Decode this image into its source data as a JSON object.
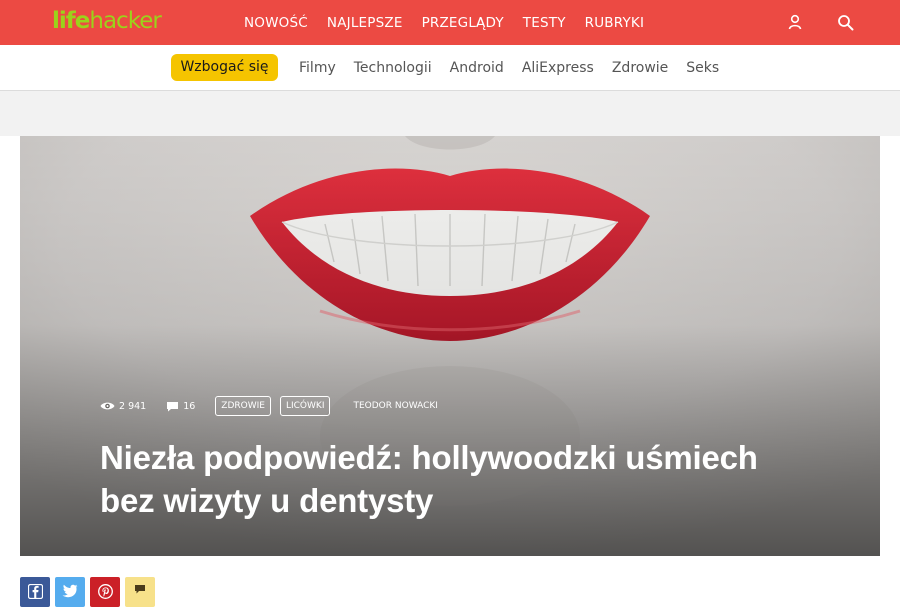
{
  "brand": {
    "logo_part1": "life",
    "logo_part2": "hacker"
  },
  "main_nav": [
    "NOWOŚĆ",
    "NAJLEPSZE",
    "PRZEGLĄDY",
    "TESTY",
    "RUBRYKI"
  ],
  "top_icons": [
    "user-icon",
    "search-icon"
  ],
  "sub_nav": {
    "highlight": "Wzbogać się",
    "links": [
      "Filmy",
      "Technologii",
      "Android",
      "AliExpress",
      "Zdrowie",
      "Seks"
    ]
  },
  "article": {
    "views": "2 941",
    "comments": "16",
    "tags": [
      "ZDROWIE",
      "LICÓWKI"
    ],
    "author": "TEODOR NOWACKI",
    "title": "Niezła podpowiedź: hollywoodzki uśmiech bez wizyty u dentysty"
  },
  "share_buttons": [
    {
      "name": "facebook-icon",
      "color": "#3b5998"
    },
    {
      "name": "twitter-icon",
      "color": "#55acee"
    },
    {
      "name": "pinterest-icon",
      "color": "#cb2027"
    },
    {
      "name": "comment-icon",
      "color": "#f7e18a"
    }
  ],
  "colors": {
    "topbar": "#ec4a43",
    "logo": "#9bd21b",
    "highlight": "#f5c400"
  }
}
